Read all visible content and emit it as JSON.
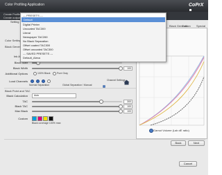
{
  "window": {
    "title": "Color Profiling Application",
    "logo_text": "CoPrX"
  },
  "header": {
    "crumb_1": "Create Profile",
    "crumb_2": "Create output profile"
  },
  "setting_label": "Setting",
  "dropdown": {
    "header": "--- PRESETS ---",
    "selected": "Default",
    "items": [
      "Digital Printer",
      "Uncoated TAC300",
      "Literal",
      "Newspaper TAC260",
      "No Black Separation",
      "Offset coated TAC300",
      "Offset uncoated TAC300",
      "--- SAVED PRESETS ---",
      "Default_Alexa"
    ]
  },
  "tabs": [
    "Black Generation",
    "Color",
    "Special"
  ],
  "left": {
    "color_settings_label": "Color Settings",
    "black_gen_label": "Black Generation",
    "ink_amount_label": "Ink Amount",
    "black_start_label": "Black Start",
    "black_width_label": "Black Width",
    "black_width_value": "100",
    "additional_options_label": "Additional Options",
    "option_100_black": "100% Black",
    "option_pure_gray": "Pure Gray",
    "load_channels_label": "Load Channels",
    "channel_settings_btn": "Channel Settings",
    "normal_separation": "Normal Separation",
    "global_separation": "Global Separation / Manual",
    "black_point_label": "Black Point and TAC",
    "black_calculation_label": "Black Calculation",
    "black_calculation_value": "Auto",
    "tac_label": "TAC",
    "tac_value": "300",
    "black_tac_label": "Black TAC",
    "black_tac_value": "100",
    "max_black_label": "Max Black",
    "max_black_value": "100",
    "custom_label": "Custom",
    "custom_note": "Black coverage 100% max",
    "home_icon": "home-icon"
  },
  "chart_legend": "Gamut Volume (Lab dE ratio)",
  "footer": {
    "back": "Back",
    "next": "Next",
    "cancel": "Cancel"
  },
  "colors": {
    "accent": "#5a8fd6",
    "cyan": "#00a0e0",
    "magenta": "#e0007a",
    "yellow": "#f2e200",
    "black": "#111111"
  }
}
